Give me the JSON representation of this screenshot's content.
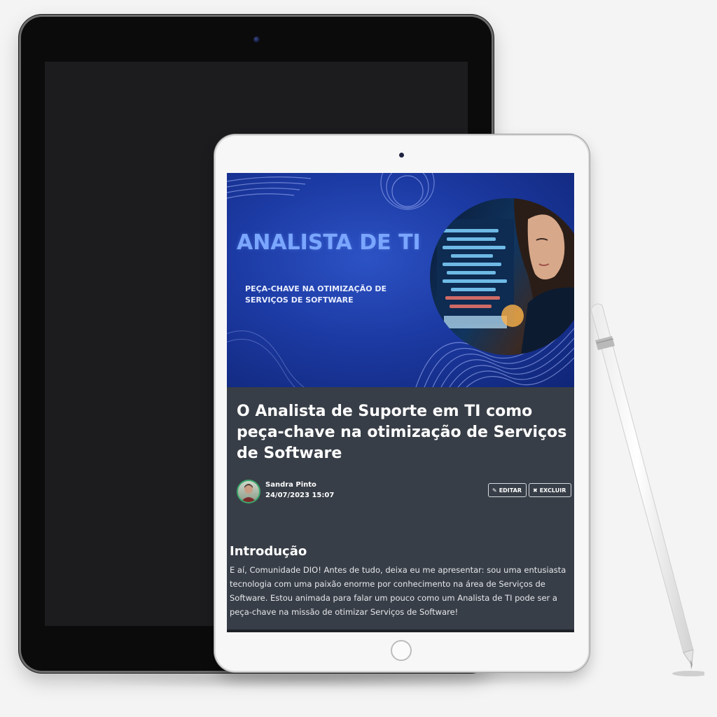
{
  "banner": {
    "title": "ANALISTA DE TI",
    "subtitle": "PEÇA-CHAVE NA OTIMIZAÇÃO DE SERVIÇOS DE SOFTWARE"
  },
  "article": {
    "title": "O Analista de Suporte em TI como peça-chave na otimização de Serviços de Software",
    "author": {
      "name": "Sandra Pinto",
      "date": "24/07/2023 15:07"
    },
    "actions": {
      "edit_label": "EDITAR",
      "delete_label": "EXCLUIR"
    },
    "intro_heading": "Introdução",
    "intro_text": "E aí, Comunidade DIO! Antes de tudo, deixa eu me apresentar: sou uma entusiasta tecnologia com uma paixão enorme por conhecimento na área de Serviços de Software. Estou animada para falar um pouco como um Analista de TI pode ser a peça-chave na missão de otimizar Serviços de Software!"
  },
  "icons": {
    "edit": "pencil-icon",
    "delete": "close-icon"
  },
  "colors": {
    "page_background": "#f4f4f4",
    "article_background": "#383e47",
    "banner_blue": "#1c3aa3",
    "banner_title": "#7aa6ff",
    "avatar_ring": "#3aa86b"
  }
}
